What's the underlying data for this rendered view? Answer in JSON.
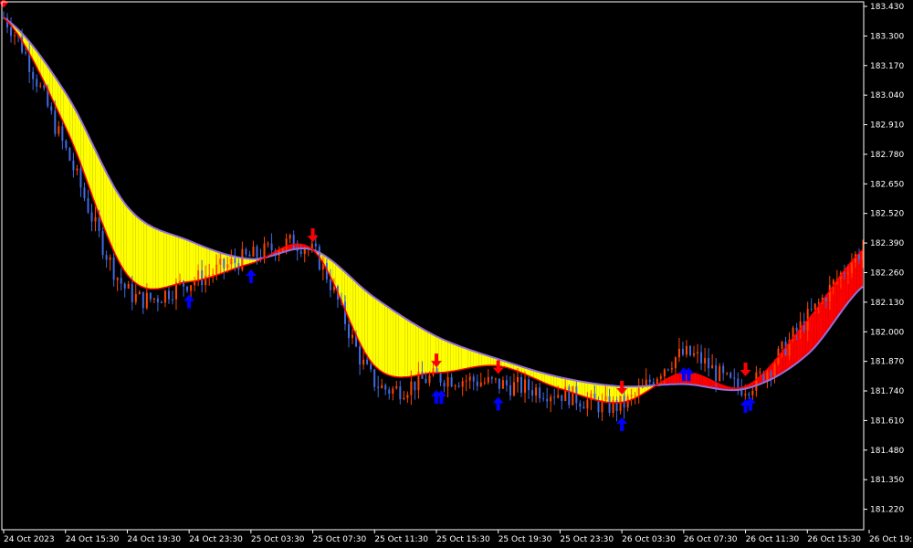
{
  "chart_data": {
    "type": "line",
    "title": "",
    "xlabel": "",
    "ylabel": "",
    "ylim": [
      181.13,
      183.45
    ],
    "grid": false,
    "y_ticks": [
      "183.430",
      "183.300",
      "183.170",
      "183.040",
      "182.910",
      "182.780",
      "182.650",
      "182.520",
      "182.390",
      "182.260",
      "182.130",
      "182.000",
      "181.870",
      "181.740",
      "181.610",
      "181.480",
      "181.350",
      "181.220"
    ],
    "x_ticks": [
      "24 Oct 2023",
      "24 Oct 15:30",
      "24 Oct 19:30",
      "24 Oct 23:30",
      "25 Oct 03:30",
      "25 Oct 07:30",
      "25 Oct 11:30",
      "25 Oct 15:30",
      "25 Oct 19:30",
      "25 Oct 23:30",
      "26 Oct 03:30",
      "26 Oct 07:30",
      "26 Oct 11:30",
      "26 Oct 15:30",
      "26 Oct 19:30"
    ],
    "colors": {
      "background": "#000000",
      "axis": "#ffffff",
      "bull_candle": "#ff4500",
      "bear_candle": "#4169e1",
      "fast_line": "#ff0000",
      "slow_line": "#9370db",
      "band_down": "#ffff00",
      "band_up": "#ff0000",
      "cross_segment": "#00ff00",
      "arrow_buy": "#0000ff",
      "arrow_sell": "#ff0000"
    },
    "series": [
      {
        "role": "price",
        "x": [
          "24 Oct 2023",
          "24 Oct 15:30",
          "24 Oct 19:30",
          "24 Oct 23:30",
          "25 Oct 03:30",
          "25 Oct 07:30",
          "25 Oct 11:30",
          "25 Oct 15:30",
          "25 Oct 19:30",
          "25 Oct 23:30",
          "26 Oct 03:30",
          "26 Oct 07:30",
          "26 Oct 11:30",
          "26 Oct 15:30",
          "26 Oct 19:30"
        ],
        "values": [
          183.38,
          182.8,
          182.18,
          182.22,
          182.33,
          182.35,
          181.78,
          181.8,
          181.77,
          181.73,
          181.68,
          181.9,
          181.76,
          182.06,
          182.38
        ]
      },
      {
        "role": "fast",
        "x": [
          "24 Oct 2023",
          "24 Oct 15:30",
          "24 Oct 19:30",
          "24 Oct 23:30",
          "25 Oct 03:30",
          "25 Oct 07:30",
          "25 Oct 11:30",
          "25 Oct 15:30",
          "25 Oct 19:30",
          "25 Oct 23:30",
          "26 Oct 03:30",
          "26 Oct 07:30",
          "26 Oct 11:30",
          "26 Oct 15:30",
          "26 Oct 19:30"
        ],
        "values": [
          183.38,
          182.9,
          182.25,
          182.22,
          182.3,
          182.36,
          181.85,
          181.82,
          181.85,
          181.75,
          181.69,
          181.82,
          181.76,
          182.05,
          182.38
        ]
      },
      {
        "role": "slow",
        "x": [
          "24 Oct 2023",
          "24 Oct 15:30",
          "24 Oct 19:30",
          "24 Oct 23:30",
          "25 Oct 03:30",
          "25 Oct 07:30",
          "25 Oct 11:30",
          "25 Oct 15:30",
          "25 Oct 19:30",
          "25 Oct 23:30",
          "26 Oct 03:30",
          "26 Oct 07:30",
          "26 Oct 11:30",
          "26 Oct 15:30",
          "26 Oct 19:30"
        ],
        "values": [
          183.38,
          183.05,
          182.55,
          182.4,
          182.32,
          182.36,
          182.15,
          181.98,
          181.88,
          181.8,
          181.76,
          181.77,
          181.75,
          181.9,
          182.22
        ]
      }
    ],
    "sell_arrows": [
      "24 Oct 2023",
      "25 Oct 07:30",
      "25 Oct 15:30",
      "25 Oct 19:30",
      "26 Oct 03:30",
      "26 Oct 11:30"
    ],
    "buy_arrows": [
      "24 Oct 23:30",
      "25 Oct 03:30",
      "25 Oct 15:30",
      "25 Oct 15:30",
      "25 Oct 19:30",
      "26 Oct 03:30",
      "26 Oct 07:30",
      "26 Oct 07:30",
      "26 Oct 11:30",
      "26 Oct 11:30"
    ]
  }
}
